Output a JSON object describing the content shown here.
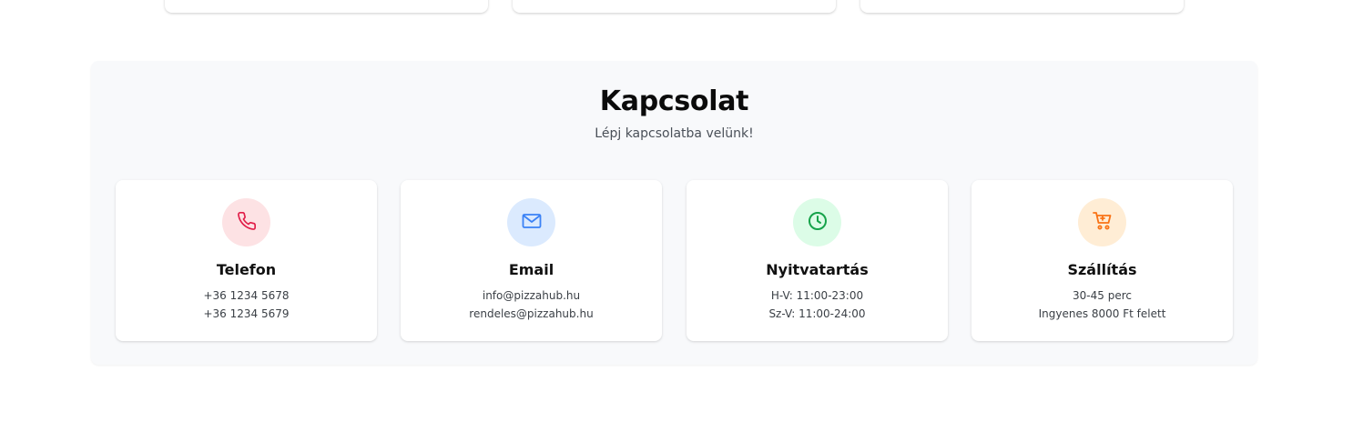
{
  "contact": {
    "title": "Kapcsolat",
    "subtitle": "Lépj kapcsolatba velünk!",
    "cards": [
      {
        "icon": "phone-icon",
        "accent": "#e11d48",
        "bg": "#fde2e4",
        "title": "Telefon",
        "line1": "+36 1234 5678",
        "line2": "+36 1234 5679"
      },
      {
        "icon": "mail-icon",
        "accent": "#3b82f6",
        "bg": "#dbeafe",
        "title": "Email",
        "line1": "info@pizzahub.hu",
        "line2": "rendeles@pizzahub.hu"
      },
      {
        "icon": "clock-icon",
        "accent": "#16a34a",
        "bg": "#dcfce7",
        "title": "Nyitvatartás",
        "line1": "H-V: 11:00-23:00",
        "line2": "Sz-V: 11:00-24:00"
      },
      {
        "icon": "cart-icon",
        "accent": "#f97316",
        "bg": "#ffedd5",
        "title": "Szállítás",
        "line1": "30-45 perc",
        "line2": "Ingyenes 8000 Ft felett"
      }
    ]
  }
}
